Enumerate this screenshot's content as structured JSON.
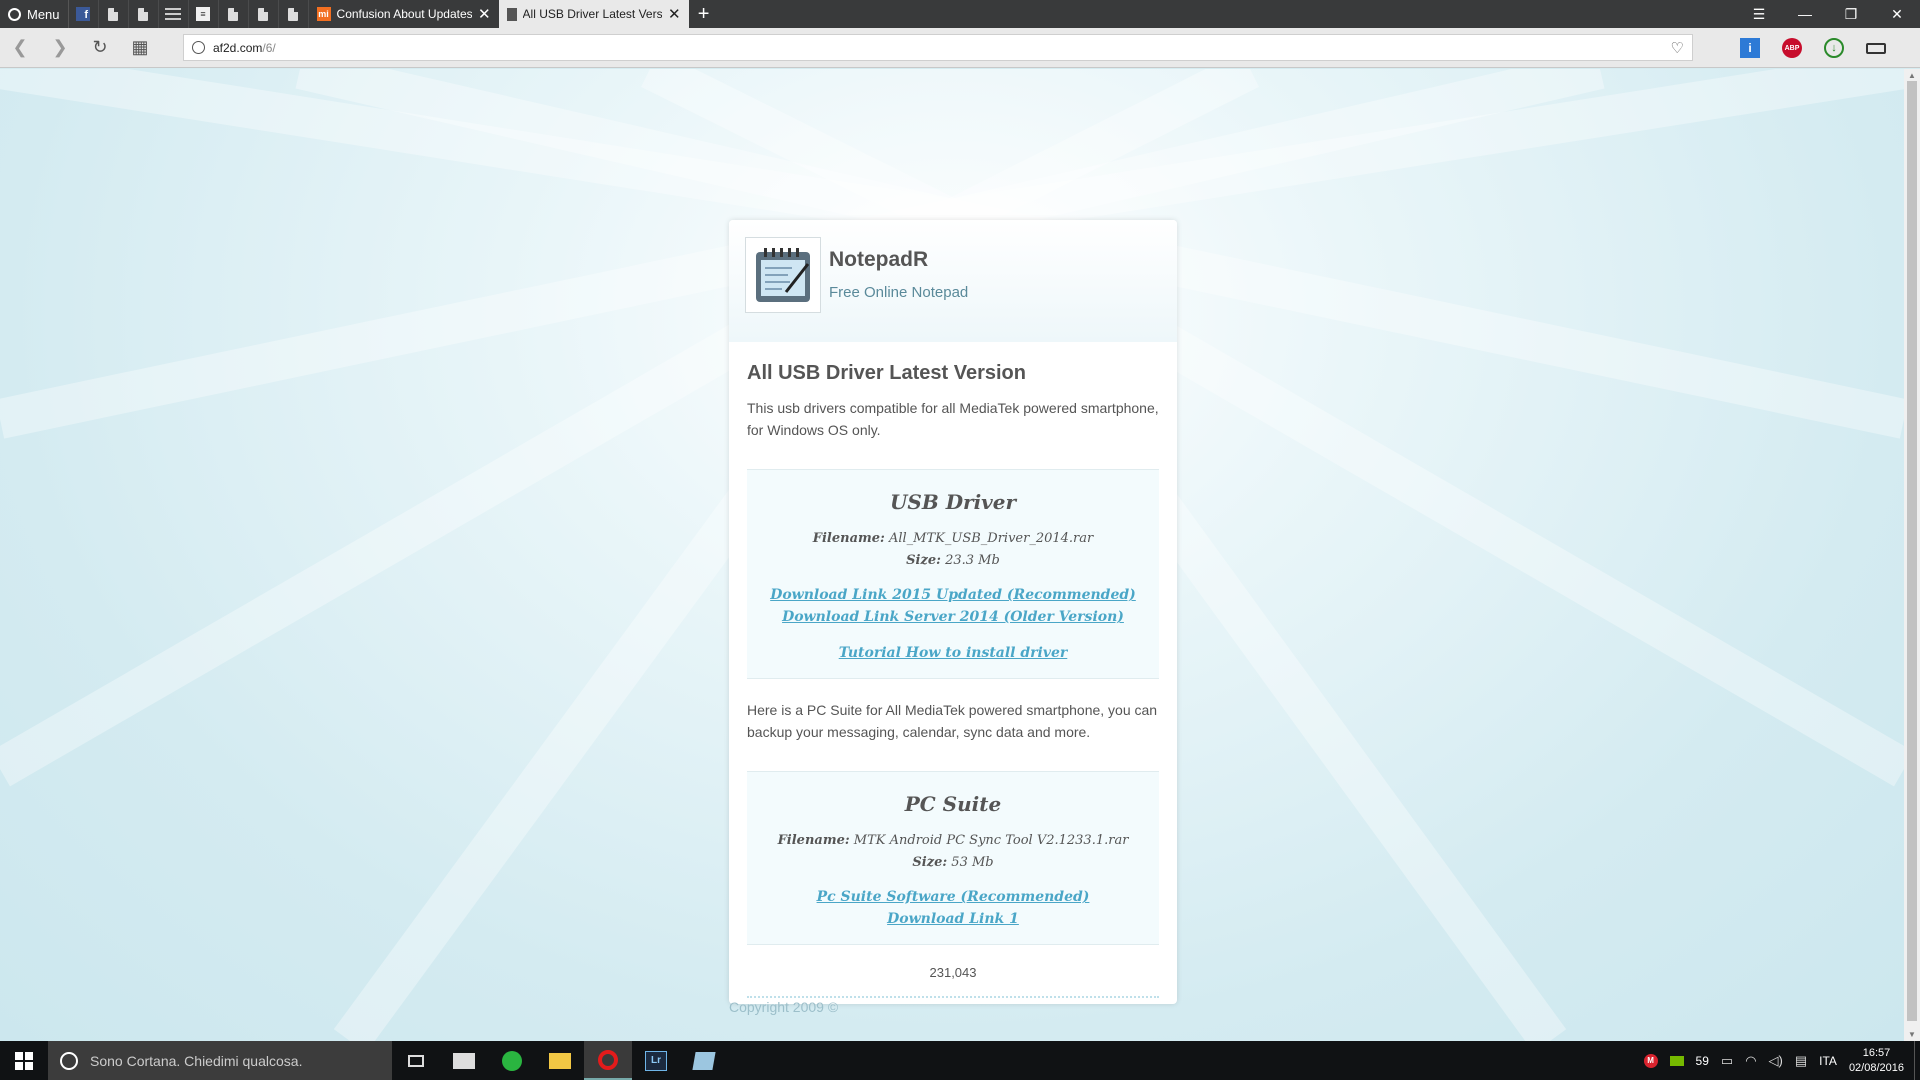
{
  "browser": {
    "menu_label": "Menu",
    "tabs": [
      {
        "title": "Confusion About Updates",
        "favicon": "mi-icon"
      },
      {
        "title": "All USB Driver Latest Versio",
        "favicon": "document-icon"
      }
    ],
    "url_host": "af2d.com",
    "url_path": "/6/"
  },
  "header": {
    "app_name": "NotepadR",
    "tagline": "Free Online Notepad"
  },
  "main": {
    "title": "All USB Driver Latest Version",
    "intro": "This usb drivers compatible for all MediaTek powered smartphone, for Windows OS only.",
    "usb_box": {
      "heading": "USB Driver",
      "filename_label": "Filename:",
      "filename": "All_MTK_USB_Driver_2014.rar",
      "size_label": "Size:",
      "size": "23.3 Mb",
      "link1": "Download Link 2015 Updated (Recommended)",
      "link2": "Download Link Server 2014 (Older Version)",
      "tutorial": "Tutorial How to install driver"
    },
    "pc_intro": "Here is a PC Suite for All MediaTek powered smartphone, you can backup your messaging, calendar, sync data and more.",
    "pc_box": {
      "heading": "PC Suite",
      "filename_label": "Filename:",
      "filename": "MTK Android PC Sync Tool V2.1233.1.rar",
      "size_label": "Size:",
      "size": "53 Mb",
      "link1": "Pc Suite Software (Recommended)",
      "link2": "Download Link 1"
    },
    "counter": "231,043"
  },
  "footer": {
    "copyright": "Copyright 2009 ©"
  },
  "taskbar": {
    "cortana_placeholder": "Sono Cortana. Chiedimi qualcosa.",
    "tray_temp": "59",
    "language": "ITA",
    "time": "16:57",
    "date": "02/08/2016"
  },
  "colors": {
    "link": "#4aa6c7",
    "page_bg": "#d6ecf1"
  }
}
